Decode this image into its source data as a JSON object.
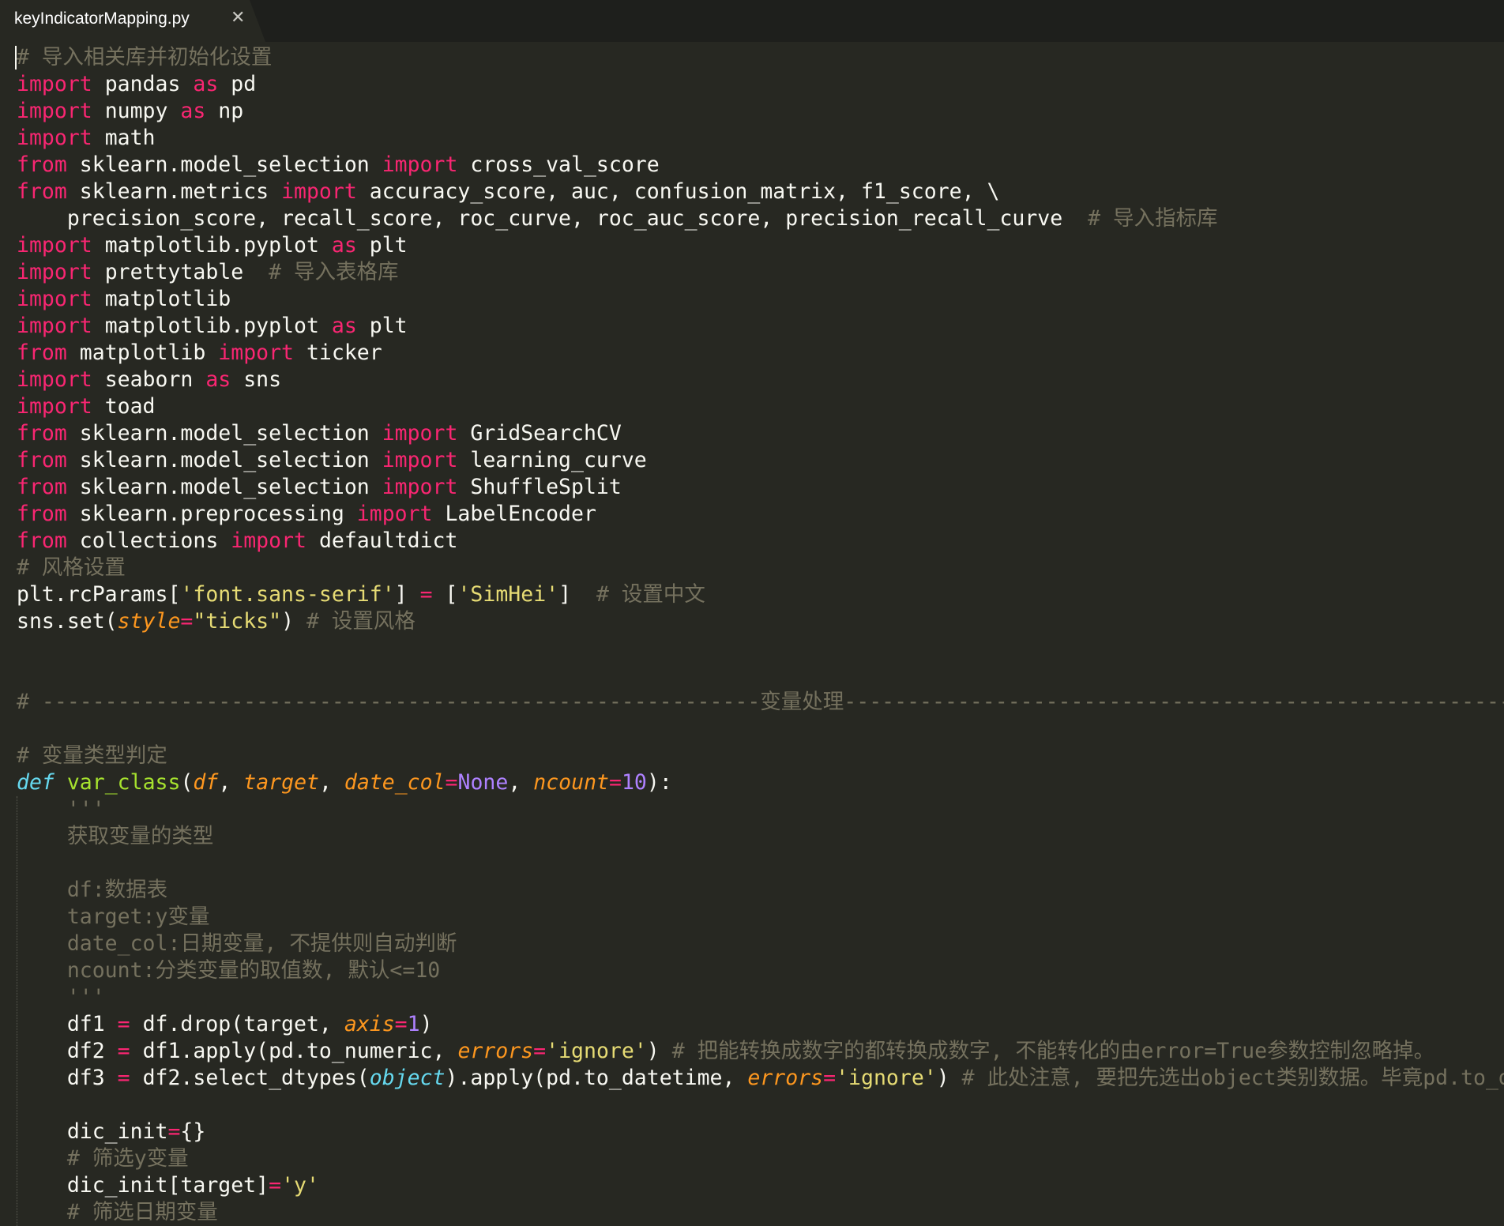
{
  "tab": {
    "filename": "keyIndicatorMapping.py",
    "close_glyph": "✕"
  },
  "theme": {
    "background": "#272822",
    "foreground": "#f8f8f2",
    "keyword": "#f92672",
    "definition": "#66d9ef",
    "function_name": "#a6e22e",
    "parameter": "#fd971f",
    "string": "#e6db74",
    "number": "#ae81ff",
    "comment": "#75715e"
  },
  "code": {
    "lines": [
      [
        [
          "cm",
          "# 导入相关库并初始化设置"
        ]
      ],
      [
        [
          "kw",
          "import"
        ],
        [
          "t",
          " pandas "
        ],
        [
          "kw",
          "as"
        ],
        [
          "t",
          " pd"
        ]
      ],
      [
        [
          "kw",
          "import"
        ],
        [
          "t",
          " numpy "
        ],
        [
          "kw",
          "as"
        ],
        [
          "t",
          " np"
        ]
      ],
      [
        [
          "kw",
          "import"
        ],
        [
          "t",
          " math"
        ]
      ],
      [
        [
          "kw",
          "from"
        ],
        [
          "t",
          " sklearn.model_selection "
        ],
        [
          "kw",
          "import"
        ],
        [
          "t",
          " cross_val_score"
        ]
      ],
      [
        [
          "kw",
          "from"
        ],
        [
          "t",
          " sklearn.metrics "
        ],
        [
          "kw",
          "import"
        ],
        [
          "t",
          " accuracy_score, auc, confusion_matrix, f1_score, \\"
        ]
      ],
      [
        [
          "t",
          "    precision_score, recall_score, roc_curve, roc_auc_score, precision_recall_curve  "
        ],
        [
          "cm",
          "# 导入指标库"
        ]
      ],
      [
        [
          "kw",
          "import"
        ],
        [
          "t",
          " matplotlib.pyplot "
        ],
        [
          "kw",
          "as"
        ],
        [
          "t",
          " plt"
        ]
      ],
      [
        [
          "kw",
          "import"
        ],
        [
          "t",
          " prettytable  "
        ],
        [
          "cm",
          "# 导入表格库"
        ]
      ],
      [
        [
          "kw",
          "import"
        ],
        [
          "t",
          " matplotlib"
        ]
      ],
      [
        [
          "kw",
          "import"
        ],
        [
          "t",
          " matplotlib.pyplot "
        ],
        [
          "kw",
          "as"
        ],
        [
          "t",
          " plt"
        ]
      ],
      [
        [
          "kw",
          "from"
        ],
        [
          "t",
          " matplotlib "
        ],
        [
          "kw",
          "import"
        ],
        [
          "t",
          " ticker"
        ]
      ],
      [
        [
          "kw",
          "import"
        ],
        [
          "t",
          " seaborn "
        ],
        [
          "kw",
          "as"
        ],
        [
          "t",
          " sns"
        ]
      ],
      [
        [
          "kw",
          "import"
        ],
        [
          "t",
          " toad"
        ]
      ],
      [
        [
          "kw",
          "from"
        ],
        [
          "t",
          " sklearn.model_selection "
        ],
        [
          "kw",
          "import"
        ],
        [
          "t",
          " GridSearchCV"
        ]
      ],
      [
        [
          "kw",
          "from"
        ],
        [
          "t",
          " sklearn.model_selection "
        ],
        [
          "kw",
          "import"
        ],
        [
          "t",
          " learning_curve"
        ]
      ],
      [
        [
          "kw",
          "from"
        ],
        [
          "t",
          " sklearn.model_selection "
        ],
        [
          "kw",
          "import"
        ],
        [
          "t",
          " ShuffleSplit"
        ]
      ],
      [
        [
          "kw",
          "from"
        ],
        [
          "t",
          " sklearn.preprocessing "
        ],
        [
          "kw",
          "import"
        ],
        [
          "t",
          " LabelEncoder"
        ]
      ],
      [
        [
          "kw",
          "from"
        ],
        [
          "t",
          " collections "
        ],
        [
          "kw",
          "import"
        ],
        [
          "t",
          " defaultdict"
        ]
      ],
      [
        [
          "cm",
          "# 风格设置"
        ]
      ],
      [
        [
          "t",
          "plt.rcParams["
        ],
        [
          "st",
          "'font.sans-serif'"
        ],
        [
          "t",
          "] "
        ],
        [
          "kw",
          "="
        ],
        [
          "t",
          " ["
        ],
        [
          "st",
          "'SimHei'"
        ],
        [
          "t",
          "]  "
        ],
        [
          "cm",
          "# 设置中文"
        ]
      ],
      [
        [
          "t",
          "sns.set("
        ],
        [
          "pa",
          "style"
        ],
        [
          "kw",
          "="
        ],
        [
          "st",
          "\"ticks\""
        ],
        [
          "t",
          ") "
        ],
        [
          "cm",
          "# 设置风格"
        ]
      ],
      [],
      [],
      [
        [
          "cm",
          "# ---------------------------------------------------------变量处理---------------------------------------------------------"
        ]
      ],
      [],
      [
        [
          "cm",
          "# 变量类型判定"
        ]
      ],
      [
        [
          "df",
          "def"
        ],
        [
          "t",
          " "
        ],
        [
          "fn",
          "var_class"
        ],
        [
          "t",
          "("
        ],
        [
          "pa",
          "df"
        ],
        [
          "t",
          ", "
        ],
        [
          "pa",
          "target"
        ],
        [
          "t",
          ", "
        ],
        [
          "pa",
          "date_col"
        ],
        [
          "kw",
          "="
        ],
        [
          "nu",
          "None"
        ],
        [
          "t",
          ", "
        ],
        [
          "pa",
          "ncount"
        ],
        [
          "kw",
          "="
        ],
        [
          "nu",
          "10"
        ],
        [
          "t",
          "):"
        ]
      ],
      [
        [
          "cm",
          "    '''"
        ]
      ],
      [
        [
          "cm",
          "    获取变量的类型"
        ]
      ],
      [],
      [
        [
          "cm",
          "    df:数据表"
        ]
      ],
      [
        [
          "cm",
          "    target:y变量"
        ]
      ],
      [
        [
          "cm",
          "    date_col:日期变量, 不提供则自动判断"
        ]
      ],
      [
        [
          "cm",
          "    ncount:分类变量的取值数, 默认<=10"
        ]
      ],
      [
        [
          "cm",
          "    '''"
        ]
      ],
      [
        [
          "t",
          "    df1 "
        ],
        [
          "kw",
          "="
        ],
        [
          "t",
          " df.drop(target, "
        ],
        [
          "pa",
          "axis"
        ],
        [
          "kw",
          "="
        ],
        [
          "nu",
          "1"
        ],
        [
          "t",
          ")"
        ]
      ],
      [
        [
          "t",
          "    df2 "
        ],
        [
          "kw",
          "="
        ],
        [
          "t",
          " df1.apply(pd.to_numeric, "
        ],
        [
          "pa",
          "errors"
        ],
        [
          "kw",
          "="
        ],
        [
          "st",
          "'ignore'"
        ],
        [
          "t",
          ") "
        ],
        [
          "cm",
          "# 把能转换成数字的都转换成数字, 不能转化的由error=True参数控制忽略掉。"
        ]
      ],
      [
        [
          "t",
          "    df3 "
        ],
        [
          "kw",
          "="
        ],
        [
          "t",
          " df2.select_dtypes("
        ],
        [
          "df",
          "object"
        ],
        [
          "t",
          ").apply(pd.to_datetime, "
        ],
        [
          "pa",
          "errors"
        ],
        [
          "kw",
          "="
        ],
        [
          "st",
          "'ignore'"
        ],
        [
          "t",
          ") "
        ],
        [
          "cm",
          "# 此处注意, 要把先选出object类别数据。毕竟pd.to_datetime"
        ]
      ],
      [],
      [
        [
          "t",
          "    dic_init"
        ],
        [
          "kw",
          "="
        ],
        [
          "t",
          "{}"
        ]
      ],
      [
        [
          "cm",
          "    # 筛选y变量"
        ]
      ],
      [
        [
          "t",
          "    dic_init[target]"
        ],
        [
          "kw",
          "="
        ],
        [
          "st",
          "'y'"
        ]
      ],
      [
        [
          "cm",
          "    # 筛选日期变量"
        ]
      ]
    ]
  }
}
